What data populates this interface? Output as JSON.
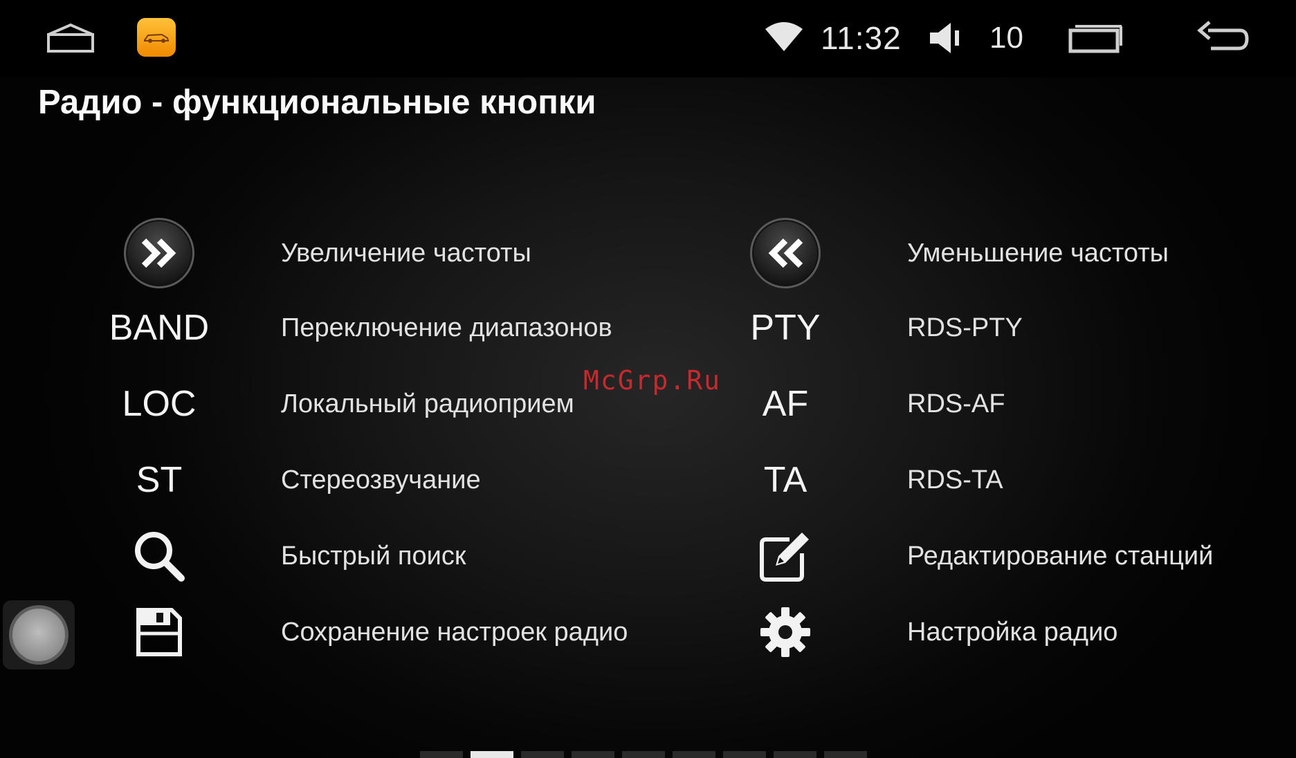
{
  "status_bar": {
    "time": "11:32",
    "volume_level": "10",
    "icons": [
      "home-icon",
      "car-app-icon",
      "wifi-icon",
      "volume-icon",
      "recents-icon",
      "back-icon"
    ]
  },
  "page_title": "Радио - функциональные кнопки",
  "legend": {
    "left": [
      {
        "icon": "fast-forward-icon",
        "label": "",
        "description": "Увеличение частоты"
      },
      {
        "icon": "",
        "label": "BAND",
        "description": "Переключение диапазонов"
      },
      {
        "icon": "",
        "label": "LOC",
        "description": "Локальный радиоприем"
      },
      {
        "icon": "",
        "label": "ST",
        "description": "Стереозвучание"
      },
      {
        "icon": "search-icon",
        "label": "",
        "description": "Быстрый поиск"
      },
      {
        "icon": "save-icon",
        "label": "",
        "description": "Сохранение настроек радио"
      }
    ],
    "right": [
      {
        "icon": "rewind-icon",
        "label": "",
        "description": "Уменьшение частоты"
      },
      {
        "icon": "",
        "label": "PTY",
        "description": "RDS-PTY"
      },
      {
        "icon": "",
        "label": "AF",
        "description": "RDS-AF"
      },
      {
        "icon": "",
        "label": "TA",
        "description": "RDS-TA"
      },
      {
        "icon": "edit-icon",
        "label": "",
        "description": "Редактирование станций"
      },
      {
        "icon": "gear-icon",
        "label": "",
        "description": "Настройка радио"
      }
    ]
  },
  "watermark": "McGrp.Ru",
  "pager": {
    "count": 9,
    "active_index": 1
  },
  "colors": {
    "background": "#000000",
    "text": "#e6e6e6",
    "accent_app": "#f5a623",
    "watermark": "#c8282e"
  }
}
